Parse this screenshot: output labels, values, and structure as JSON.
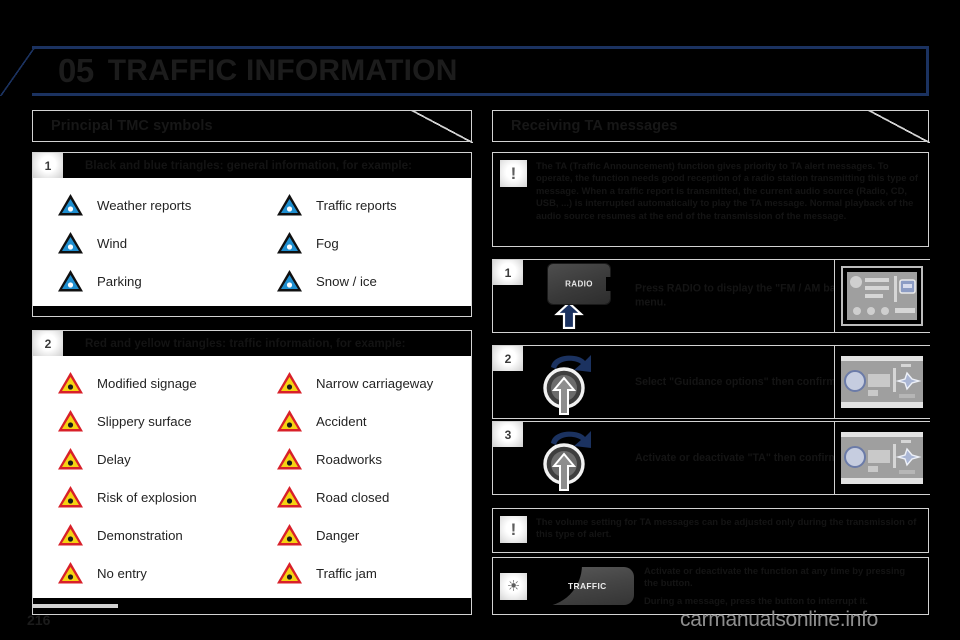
{
  "document": {
    "chapter_number": "05",
    "chapter_title": "TRAFFIC INFORMATION",
    "page_number": "216",
    "watermark": "carmanualsonline.info",
    "accent_color": "#1b3260",
    "frame_color": "#d2d2d2"
  },
  "left_column": {
    "section_title": "Principal TMC symbols",
    "categories": [
      {
        "badge": "1",
        "caption": "Black and blue triangles: general information, for example:",
        "symbols": [
          {
            "label": "Weather reports",
            "icon": "blue-triangle-weather-icon",
            "style": "blue"
          },
          {
            "label": "Traffic reports",
            "icon": "blue-triangle-info-icon",
            "style": "blue"
          },
          {
            "label": "Wind",
            "icon": "blue-triangle-wind-icon",
            "style": "blue"
          },
          {
            "label": "Fog",
            "icon": "blue-triangle-fog-icon",
            "style": "blue"
          },
          {
            "label": "Parking",
            "icon": "blue-triangle-parking-icon",
            "style": "blue"
          },
          {
            "label": "Snow / ice",
            "icon": "blue-triangle-snow-icon",
            "style": "blue"
          }
        ]
      },
      {
        "badge": "2",
        "caption": "Red and yellow triangles: traffic information, for example:",
        "symbols": [
          {
            "label": "Modified signage",
            "icon": "red-triangle-traffic-light-icon",
            "style": "red"
          },
          {
            "label": "Narrow carriageway",
            "icon": "red-triangle-narrow-road-icon",
            "style": "red"
          },
          {
            "label": "Slippery surface",
            "icon": "red-triangle-slippery-icon",
            "style": "red"
          },
          {
            "label": "Accident",
            "icon": "red-triangle-accident-icon",
            "style": "red"
          },
          {
            "label": "Delay",
            "icon": "red-triangle-clock-icon",
            "style": "red"
          },
          {
            "label": "Roadworks",
            "icon": "red-triangle-roadworks-icon",
            "style": "red"
          },
          {
            "label": "Risk of explosion",
            "icon": "red-triangle-explosion-icon",
            "style": "red"
          },
          {
            "label": "Road closed",
            "icon": "red-triangle-road-closed-icon",
            "style": "red"
          },
          {
            "label": "Demonstration",
            "icon": "red-triangle-demonstration-icon",
            "style": "red"
          },
          {
            "label": "Danger",
            "icon": "red-triangle-exclamation-icon",
            "style": "red"
          },
          {
            "label": "No entry",
            "icon": "red-triangle-no-entry-icon",
            "style": "red"
          },
          {
            "label": "Traffic jam",
            "icon": "red-triangle-traffic-jam-icon",
            "style": "red"
          }
        ]
      }
    ]
  },
  "right_column": {
    "section_title": "Receiving TA messages",
    "intro_note": {
      "icon": "exclamation-note-icon",
      "text": "The TA (Traffic Announcement) function gives priority to TA alert messages. To operate, the function needs good reception of a radio station transmitting this type of message. When a traffic report is transmitted, the current audio source (Radio, CD, USB, ...) is interrupted automatically to play the TA message. Normal playback of the audio source resumes at the end of the transmission of the message."
    },
    "steps": [
      {
        "badge": "1",
        "control": "radio-button",
        "control_label": "RADIO",
        "text": "Press RADIO to display the \"FM / AM band\" menu.",
        "thumbnail": "radio-panel-thumbnail"
      },
      {
        "badge": "2",
        "control": "rotary-knob",
        "control_label": "",
        "text": "Select \"Guidance options\" then confirm.",
        "thumbnail": "knob-panel-thumbnail"
      },
      {
        "badge": "3",
        "control": "rotary-knob",
        "control_label": "",
        "text": "Activate or deactivate \"TA\" then confirm.",
        "thumbnail": "knob-panel-thumbnail"
      }
    ],
    "volume_note": {
      "icon": "exclamation-note-icon",
      "text": "The volume setting for TA messages can be adjusted only during the transmission of this type of alert."
    },
    "traffic_note": {
      "icon": "lightbulb-note-icon",
      "button_label": "TRAFFIC",
      "line1": "Activate or deactivate the function at any time by pressing the button.",
      "line2": "During a message, press the button to interrupt it."
    }
  }
}
